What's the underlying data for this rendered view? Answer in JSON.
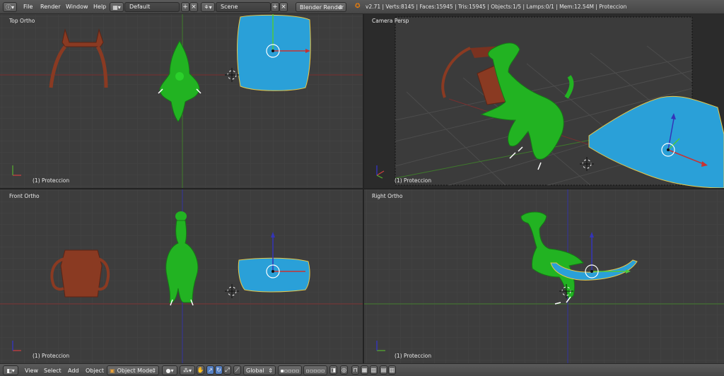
{
  "header": {
    "menus": [
      "File",
      "Render",
      "Window",
      "Help"
    ],
    "screen_layout": "Default",
    "scene": "Scene",
    "render_engine": "Blender Render",
    "stats": "v2.71 | Verts:8145 | Faces:15945 | Tris:15945 | Objects:1/5 | Lamps:0/1 | Mem:12.54M | Proteccion"
  },
  "viewports": {
    "top_left": {
      "label": "Top Ortho",
      "object": "(1) Proteccion"
    },
    "top_right": {
      "label": "Camera Persp",
      "object": "(1) Proteccion"
    },
    "bottom_left": {
      "label": "Front Ortho",
      "object": "(1) Proteccion"
    },
    "bottom_right": {
      "label": "Right Ortho",
      "object": "(1) Proteccion"
    }
  },
  "footer": {
    "menus": [
      "View",
      "Select",
      "Add",
      "Object"
    ],
    "mode": "Object Mode",
    "orientation": "Global"
  },
  "colors": {
    "dino": "#22b322",
    "seat": "#2aa0d8",
    "chair": "#8a3a22",
    "grid_bg": "#3d3d3d",
    "x_axis": "#b83232",
    "y_axis": "#5c9a2c",
    "z_axis": "#3434b8"
  }
}
